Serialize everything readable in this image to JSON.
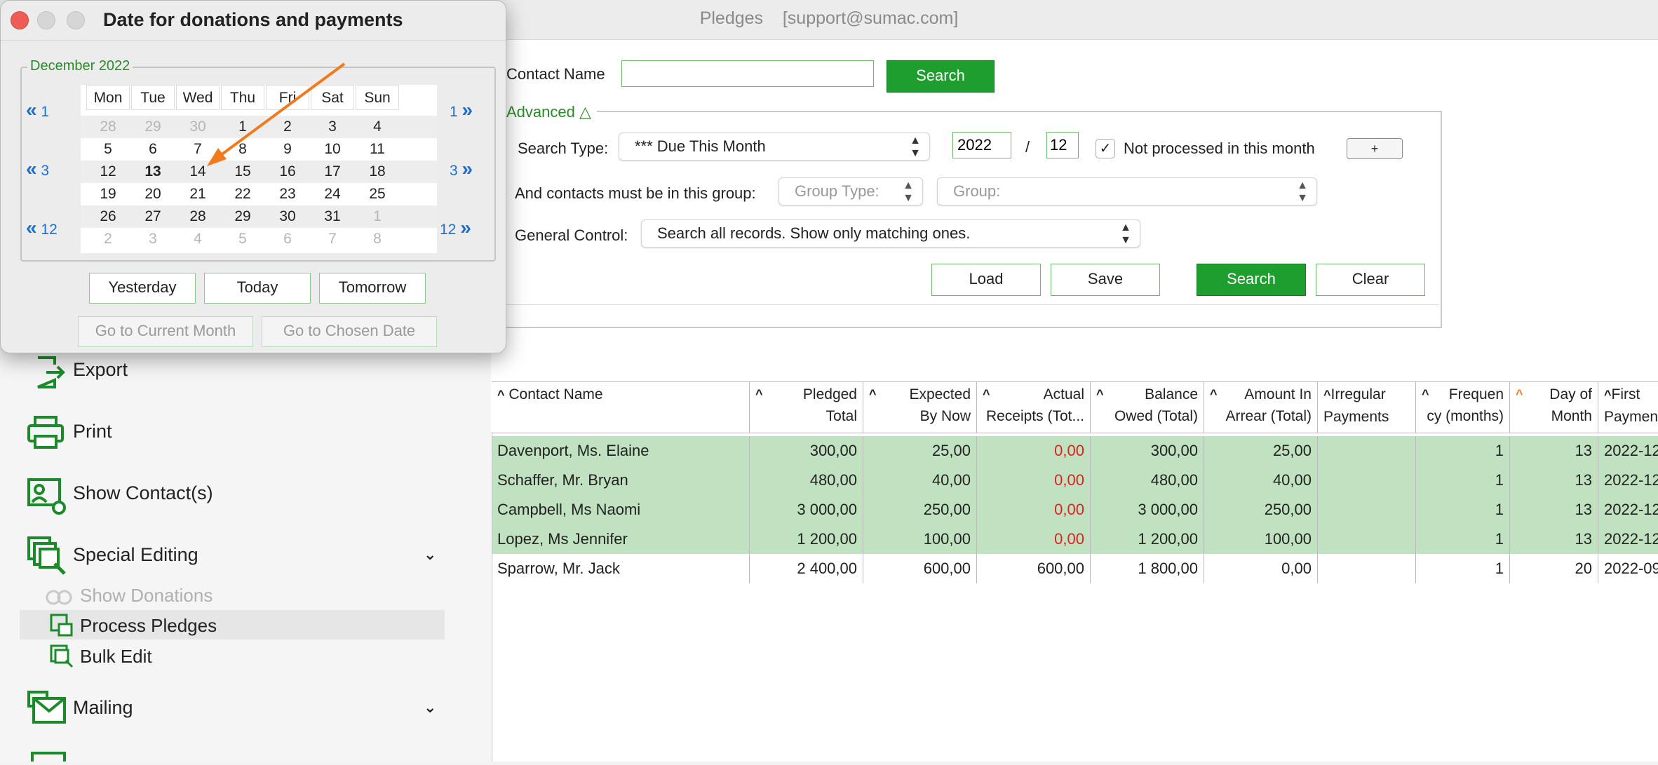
{
  "window": {
    "title": "Pledges",
    "user": "[support@sumac.com]"
  },
  "dialog": {
    "title": "Date for donations and payments",
    "month_label": "December 2022",
    "weekdays": [
      "Mon",
      "Tue",
      "Wed",
      "Thu",
      "Fri",
      "Sat",
      "Sun"
    ],
    "weeks": [
      [
        "28",
        "29",
        "30",
        "1",
        "2",
        "3",
        "4"
      ],
      [
        "5",
        "6",
        "7",
        "8",
        "9",
        "10",
        "11"
      ],
      [
        "12",
        "13",
        "14",
        "15",
        "16",
        "17",
        "18"
      ],
      [
        "19",
        "20",
        "21",
        "22",
        "23",
        "24",
        "25"
      ],
      [
        "26",
        "27",
        "28",
        "29",
        "30",
        "31",
        "1"
      ],
      [
        "2",
        "3",
        "4",
        "5",
        "6",
        "7",
        "8"
      ]
    ],
    "selected_day": "13",
    "nav_left": [
      "1",
      "3",
      "12"
    ],
    "nav_right": [
      "1",
      "3",
      "12"
    ],
    "buttons": {
      "yesterday": "Yesterday",
      "today": "Today",
      "tomorrow": "Tomorrow",
      "current_month": "Go to Current Month",
      "chosen_date": "Go to Chosen Date"
    }
  },
  "search": {
    "contact_label": "Contact Name",
    "contact_value": "",
    "search_button": "Search",
    "advanced_label": "Advanced △",
    "search_type_label": "Search Type:",
    "search_type_value": "*** Due This Month",
    "year": "2022",
    "slash": "/",
    "month": "12",
    "not_processed_label": "Not processed in this month",
    "plus_button": "+",
    "group_label": "And contacts must be in this group:",
    "group_type_placeholder": "Group Type:",
    "group_placeholder": "Group:",
    "general_label": "General Control:",
    "general_value": "Search all records. Show only matching ones.",
    "load": "Load",
    "save": "Save",
    "search2": "Search",
    "clear": "Clear"
  },
  "nav": {
    "export": "Export",
    "print": "Print",
    "show_contacts": "Show Contact(s)",
    "special_editing": "Special Editing",
    "show_donations": "Show Donations",
    "process_pledges": "Process Pledges",
    "bulk_edit": "Bulk Edit",
    "mailing": "Mailing"
  },
  "table": {
    "columns": [
      {
        "l1": "Contact Name",
        "l2": ""
      },
      {
        "l1": "Pledged",
        "l2": "Total"
      },
      {
        "l1": "Expected",
        "l2": "By Now"
      },
      {
        "l1": "Actual",
        "l2": "Receipts (Tot..."
      },
      {
        "l1": "Balance",
        "l2": "Owed (Total)"
      },
      {
        "l1": "Amount In",
        "l2": "Arrear (Total)"
      },
      {
        "l1": "Irregular",
        "l2": "Payments"
      },
      {
        "l1": "Frequen",
        "l2": "cy (months)"
      },
      {
        "l1": "Day of",
        "l2": "Month"
      },
      {
        "l1": "First",
        "l2": "Paymen"
      }
    ],
    "rows": [
      [
        "Davenport, Ms. Elaine",
        "300,00",
        "25,00",
        "0,00",
        "300,00",
        "25,00",
        "",
        "1",
        "13",
        "2022-12"
      ],
      [
        "Schaffer, Mr. Bryan",
        "480,00",
        "40,00",
        "0,00",
        "480,00",
        "40,00",
        "",
        "1",
        "13",
        "2022-12"
      ],
      [
        "Campbell, Ms Naomi",
        "3 000,00",
        "250,00",
        "0,00",
        "3 000,00",
        "250,00",
        "",
        "1",
        "13",
        "2022-12"
      ],
      [
        "Lopez, Ms Jennifer",
        "1 200,00",
        "100,00",
        "0,00",
        "1 200,00",
        "100,00",
        "",
        "1",
        "13",
        "2022-12"
      ],
      [
        "Sparrow, Mr. Jack",
        "2 400,00",
        "600,00",
        "600,00",
        "1 800,00",
        "0,00",
        "",
        "1",
        "20",
        "2022-09"
      ]
    ]
  },
  "colors": {
    "accent_green": "#1e9e2e",
    "selected_row": "#c0e2c0",
    "link_blue": "#1d6fcf",
    "negative_red": "#e02020",
    "arrow_orange": "#f07b1e"
  }
}
